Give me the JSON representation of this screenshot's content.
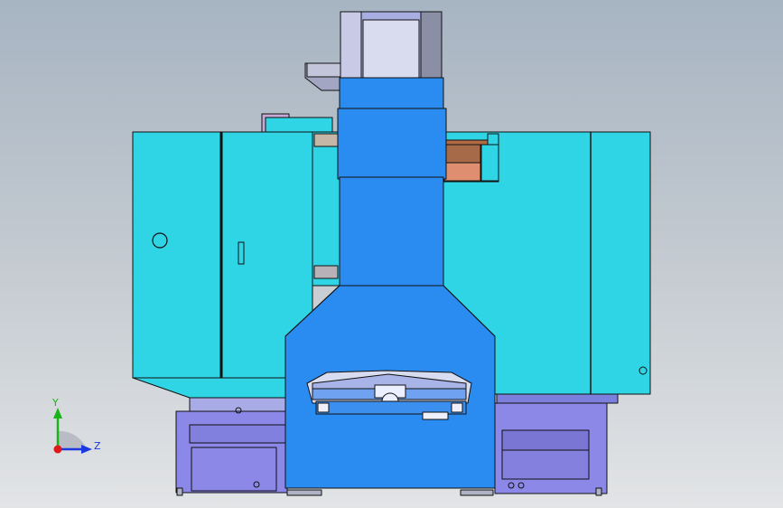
{
  "colors": {
    "cyan_panel": "#2fd5e5",
    "blue_column": "#2a8cf0",
    "violet_base": "#8c88e8",
    "lavender": "#aeaee8",
    "copper": "#c87f5e",
    "grey_head": "#bfc4d8",
    "outline": "#111111"
  },
  "triad": {
    "y_label": "Y",
    "z_label": "Z",
    "y_color": "#18b418",
    "z_color": "#1c38e0",
    "x_color": "#e01818"
  }
}
